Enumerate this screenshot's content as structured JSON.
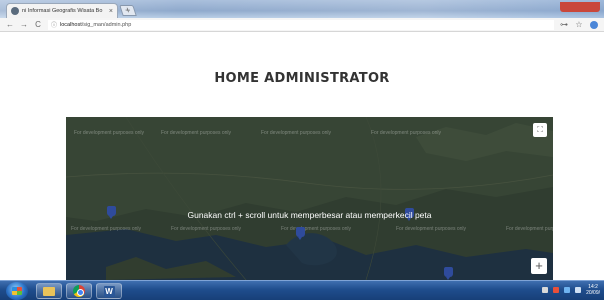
{
  "browser": {
    "tab_title": "ni Informasi Geografis Wisata Bo",
    "tab_close": "×",
    "new_tab": "+",
    "url_host": "localhost",
    "url_path": "/sig_man/admin.php",
    "back_icon": "←",
    "forward_icon": "→",
    "reload_icon": "C",
    "info_icon": "ⓘ",
    "bookmark_icon": "☆",
    "key_icon": "⊶"
  },
  "page": {
    "heading": "HOME ADMINISTRATOR"
  },
  "map": {
    "overlay_message": "Gunakan ctrl + scroll untuk memperbesar atau memperkecil peta",
    "watermark_text": "For development purposes only",
    "fullscreen_icon": "⛶",
    "zoom_in_label": "+",
    "marker_color": "#2f4b9c"
  },
  "taskbar": {
    "word_label": "W",
    "clock_time": "14:2",
    "clock_date": "20/09/"
  }
}
